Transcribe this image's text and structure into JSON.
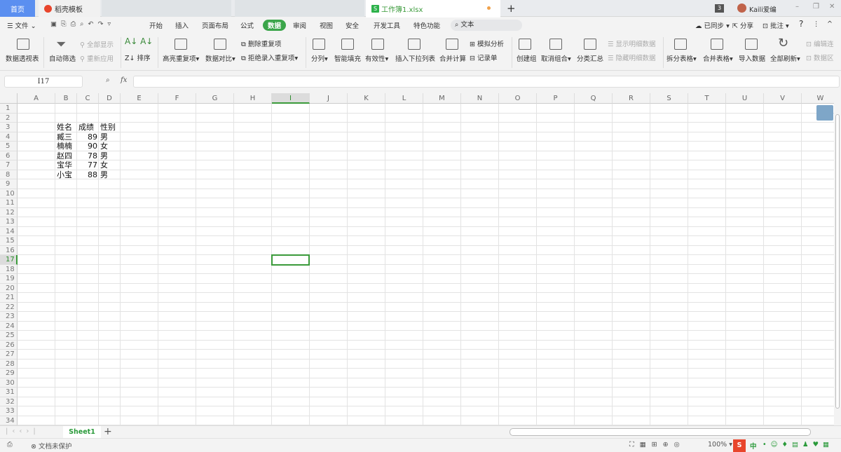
{
  "tabs": {
    "home": "首页",
    "template": "稻壳模板",
    "active": "工作簿1.xlsx",
    "new_tab": "+"
  },
  "window": {
    "badge": "3",
    "user": "Kaili爱编",
    "minimize": "–",
    "restore": "❐",
    "close": "✕"
  },
  "menu": {
    "file": "文件",
    "items": [
      "开始",
      "插入",
      "页面布局",
      "公式",
      "数据",
      "审阅",
      "视图",
      "安全",
      "开发工具",
      "特色功能"
    ],
    "active_index": 4,
    "search": "文本",
    "sync": "已同步",
    "share": "分享",
    "comment": "批注",
    "help": "?",
    "more": "⋮",
    "collapse": "^"
  },
  "ribbon": {
    "pivot": "数据透视表",
    "autofilter": "自动筛选",
    "show_all": "全部显示",
    "reapply": "重新应用",
    "sort": "排序",
    "highlight_dup": "高亮重复项",
    "compare": "数据对比",
    "remove_dup": "删除重复项",
    "reject_dup": "拒绝录入重复项",
    "split": "分列",
    "smart_fill": "智能填充",
    "validity": "有效性",
    "dropdown_list": "插入下拉列表",
    "consolidate": "合并计算",
    "what_if": "模拟分析",
    "record": "记录单",
    "group": "创建组",
    "ungroup": "取消组合",
    "subtotal": "分类汇总",
    "show_detail": "显示明细数据",
    "hide_detail": "隐藏明细数据",
    "split_table": "拆分表格",
    "merge_table": "合并表格",
    "import": "导入数据",
    "refresh_all": "全部刷新",
    "edit_link": "编辑连",
    "data_area": "数据区"
  },
  "formula_bar": {
    "name_box": "I17",
    "fx": "fx",
    "value": ""
  },
  "columns": [
    "A",
    "B",
    "C",
    "D",
    "E",
    "F",
    "G",
    "H",
    "I",
    "J",
    "K",
    "L",
    "M",
    "N",
    "O",
    "P",
    "Q",
    "R",
    "S",
    "T",
    "U",
    "V",
    "W"
  ],
  "selected_cell": {
    "col": "I",
    "row": 17
  },
  "cells": {
    "header": [
      "姓名",
      "成绩",
      "性别"
    ],
    "rows": [
      [
        "臧三",
        "89",
        "男"
      ],
      [
        "楠楠",
        "90",
        "女"
      ],
      [
        "赵四",
        "78",
        "男"
      ],
      [
        "宝华",
        "77",
        "女"
      ],
      [
        "小宝",
        "88",
        "男"
      ]
    ]
  },
  "sheets": {
    "tabs": [
      "Sheet1"
    ],
    "add": "+"
  },
  "status": {
    "protect": "文档未保护",
    "zoom": "100%",
    "ime": "中"
  }
}
